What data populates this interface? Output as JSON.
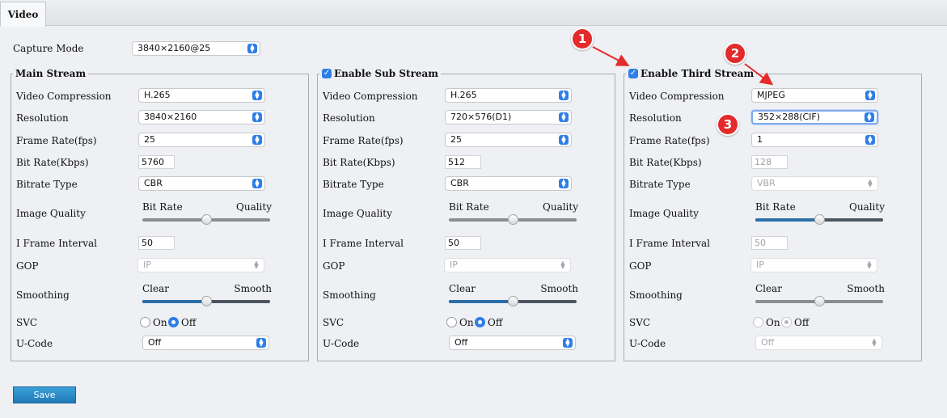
{
  "tabs": [
    {
      "label": "Video"
    }
  ],
  "capture": {
    "label": "Capture Mode",
    "value": "3840×2160@25"
  },
  "labels": {
    "video_compression": "Video Compression",
    "resolution": "Resolution",
    "frame_rate": "Frame Rate(fps)",
    "bit_rate": "Bit Rate(Kbps)",
    "bitrate_type": "Bitrate Type",
    "image_quality": "Image Quality",
    "iframe_interval": "I Frame Interval",
    "gop": "GOP",
    "smoothing": "Smoothing",
    "svc": "SVC",
    "ucode": "U-Code",
    "bitrate_cap": "Bit Rate",
    "quality_cap": "Quality",
    "clear_cap": "Clear",
    "smooth_cap": "Smooth",
    "on": "On",
    "off": "Off"
  },
  "streams": [
    {
      "title": "Main Stream",
      "checkbox": false,
      "checked": false,
      "video_compression": "H.265",
      "resolution": "3840×2160",
      "frame_rate": "25",
      "bit_rate": "5760",
      "bitrate_type": "CBR",
      "bitrate_type_disabled": false,
      "image_quality_level": 0.5,
      "image_quality_disabled": true,
      "iframe_interval": "50",
      "gop": "IP",
      "smoothing_level": 0.5,
      "smoothing_disabled": false,
      "svc": "Off",
      "svc_disabled": false,
      "ucode": "Off",
      "ucode_disabled": false,
      "resolution_focused": false
    },
    {
      "title": "Enable  Sub Stream",
      "checkbox": true,
      "checked": true,
      "video_compression": "H.265",
      "resolution": "720×576(D1)",
      "frame_rate": "25",
      "bit_rate": "512",
      "bitrate_type": "CBR",
      "bitrate_type_disabled": false,
      "image_quality_level": 0.5,
      "image_quality_disabled": true,
      "iframe_interval": "50",
      "gop": "IP",
      "smoothing_level": 0.5,
      "smoothing_disabled": false,
      "svc": "Off",
      "svc_disabled": false,
      "ucode": "Off",
      "ucode_disabled": false,
      "resolution_focused": false
    },
    {
      "title": "Enable  Third Stream",
      "checkbox": true,
      "checked": true,
      "video_compression": "MJPEG",
      "resolution": "352×288(CIF)",
      "frame_rate": "1",
      "bit_rate": "128",
      "bit_rate_disabled": true,
      "bitrate_type": "VBR",
      "bitrate_type_disabled": true,
      "image_quality_level": 0.5,
      "image_quality_disabled": false,
      "iframe_interval": "50",
      "iframe_disabled": true,
      "gop": "IP",
      "smoothing_level": 0.5,
      "smoothing_disabled": true,
      "svc": "Off",
      "svc_disabled": true,
      "ucode": "Off",
      "ucode_disabled": true,
      "resolution_focused": true
    }
  ],
  "save": {
    "label": "Save"
  },
  "annotations": [
    "1",
    "2",
    "3"
  ],
  "colors": {
    "accent": "#2f7ee8",
    "badge": "#e32b2b",
    "save_button": "#2a8ccc"
  }
}
